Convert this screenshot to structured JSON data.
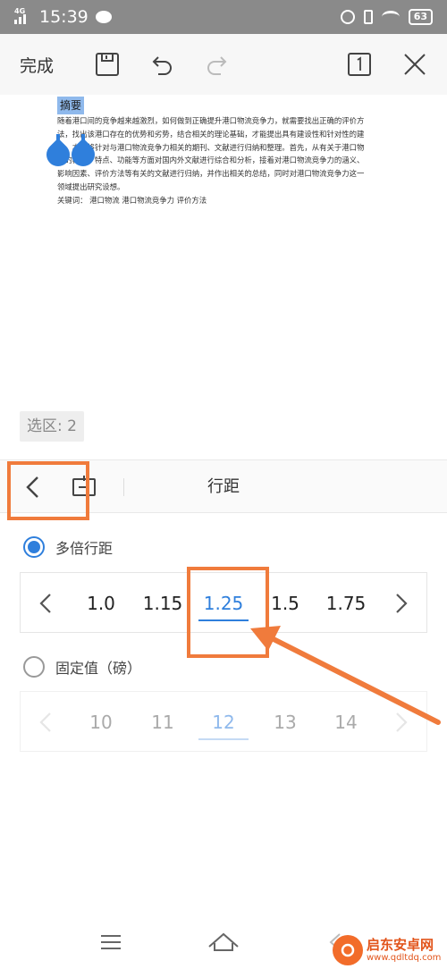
{
  "status_bar": {
    "network": "4G",
    "time": "15:39",
    "battery": "63"
  },
  "toolbar": {
    "done_label": "完成"
  },
  "document": {
    "abstract_title": "摘要",
    "lines": [
      "随着港口间的竞争越来越激烈，如何做到正确提升港口物流竞争力，就需要找出正确的评价方",
      "法，找出该港口存在的优势和劣势，结合相关的理论基础，才能提出具有建设性和针对性的建",
      "议。本文将针对与港口物流竞争力相关的期刊、文献进行归纳和整理。首先，从有关于港口物",
      "流的概念、特点、功能等方面对国内外文献进行综合和分析，接着对港口物流竞争力的涵义、",
      "影响因素、评价方法等有关的文献进行归纳，并作出相关的总结，同时对港口物流竞争力这一",
      "领域提出研究设想。",
      "关键词：  港口物流  港口物流竞争力    评价方法"
    ]
  },
  "selection_badge": "选区: 2",
  "panel": {
    "title": "行距",
    "multiple": {
      "label": "多倍行距",
      "selected": true,
      "values": [
        "1.0",
        "1.15",
        "1.25",
        "1.5",
        "1.75"
      ],
      "selected_value": "1.25"
    },
    "fixed": {
      "label": "固定值（磅）",
      "selected": false,
      "values": [
        "10",
        "11",
        "12",
        "13",
        "14"
      ],
      "selected_value": "12"
    }
  },
  "colors": {
    "accent": "#2f7fdc",
    "annotation": "#f07b3c",
    "status_bar": "#8a8a8a"
  },
  "watermark": {
    "brand": "启东安卓网",
    "url": "www.qdltdq.com"
  }
}
